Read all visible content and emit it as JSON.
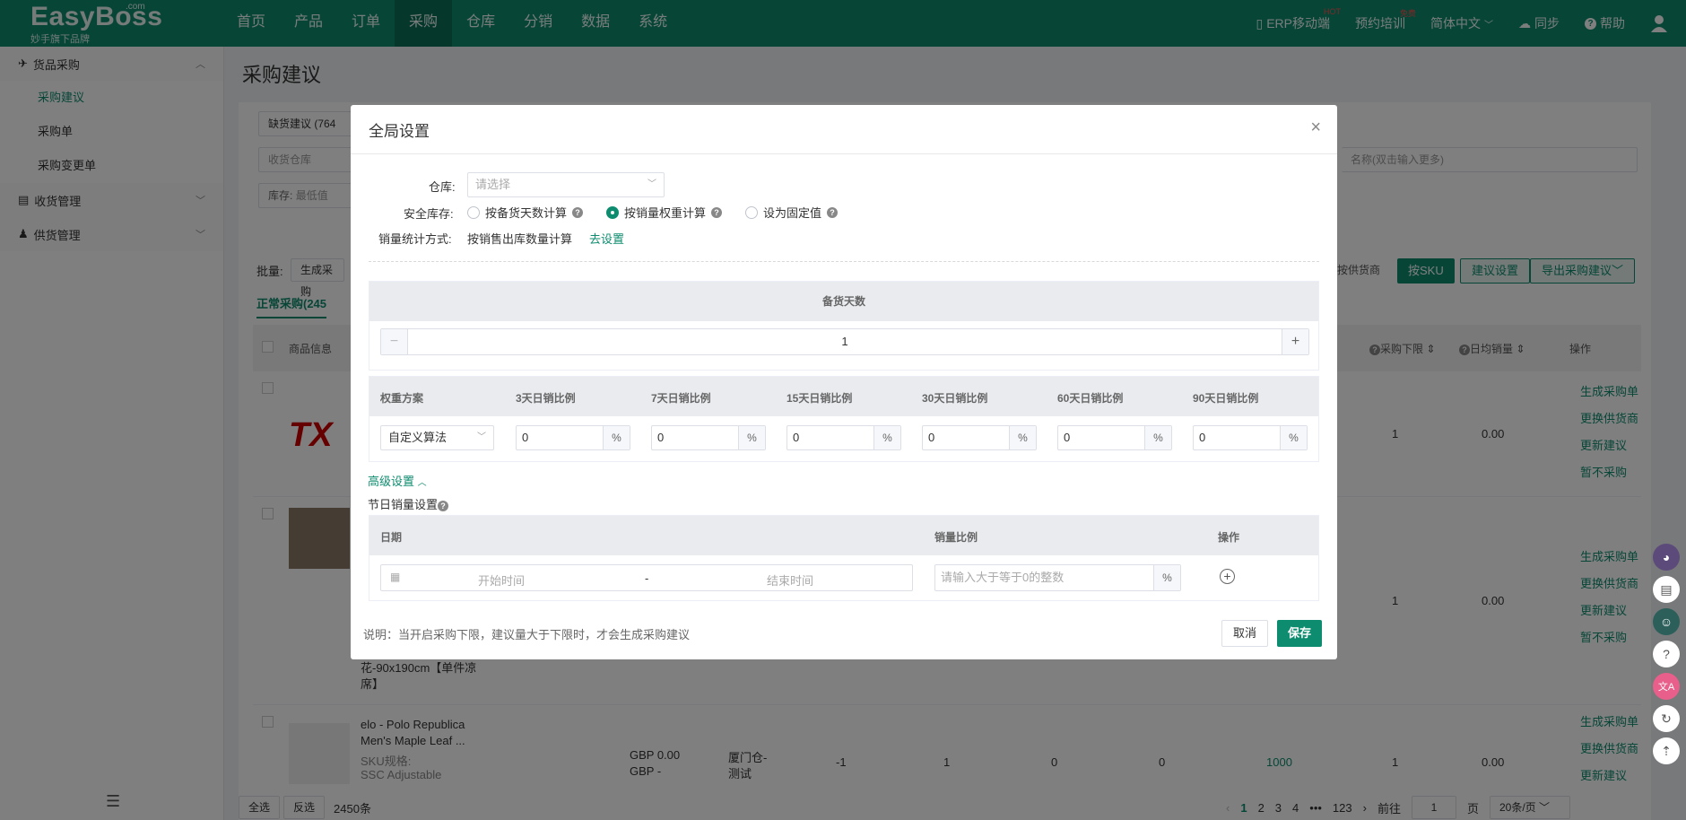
{
  "nav": {
    "logo": "EasyBoss",
    "logo_com": ".com",
    "logo_sub": "妙手旗下品牌",
    "menu": [
      "首页",
      "产品",
      "订单",
      "采购",
      "仓库",
      "分销",
      "数据",
      "系统"
    ],
    "active_index": 3,
    "right": {
      "erp_mobile": "ERP移动端",
      "erp_badge": "HOT",
      "training": "预约培训",
      "training_badge": "免费",
      "language": "简体中文",
      "sync": "同步",
      "help": "帮助"
    }
  },
  "sidebar": {
    "groups": [
      {
        "label": "货品采购",
        "items": [
          "采购建议",
          "采购单",
          "采购变更单"
        ]
      },
      {
        "label": "收货管理"
      },
      {
        "label": "供货管理"
      }
    ],
    "active_item": "采购建议"
  },
  "page": {
    "title": "采购建议",
    "filter_suggest": "缺货建议 (764",
    "filter_warehouse": "收货仓库",
    "filter_stock_label": "库存:",
    "filter_stock_min": "最低值",
    "filter_name_ph": "名称(双击输入更多)",
    "batch_label": "批量:",
    "batch_btn": "生成采购",
    "tab_normal": "正常采购(245",
    "by_supplier": "按供货商",
    "by_sku": "按SKU",
    "suggest_settings": "建议设置",
    "export": "导出采购建议",
    "table_head": {
      "product": "商品信息",
      "min_limit": "采购下限",
      "daily_sales": "日均销量",
      "ops": "操作"
    },
    "rows": [
      {
        "min": "1",
        "daily": "0.00",
        "ops": [
          "生成采购单",
          "更换供货商",
          "更新建议",
          "暂不采购"
        ]
      },
      {
        "min": "1",
        "daily": "0.00",
        "ops": [
          "生成采购单",
          "更换供货商",
          "更新建议",
          "暂不采购"
        ],
        "product_tail_1": "花-90x190cm【单件凉",
        "product_tail_2": "席】"
      },
      {
        "product_name_1": "elo - Polo Republica",
        "product_name_2": "Men's Maple Leaf ...",
        "sku_label": "SKU规格:",
        "sku_value": "SSC Adjustable",
        "price_1": "GBP 0.00",
        "price_2": "GBP -",
        "warehouse_1": "厦门仓-",
        "warehouse_2": "测试",
        "c1": "-1",
        "c2": "1",
        "c3": "0",
        "c4": "0",
        "c5": "1000",
        "min": "1",
        "daily": "0.00",
        "ops": [
          "生成采购单",
          "更换供货商",
          "更新建议"
        ]
      }
    ],
    "footer": {
      "select_all": "全选",
      "invert": "反选",
      "count": "2450条",
      "pages": [
        "1",
        "2",
        "3",
        "4",
        "•••",
        "123"
      ],
      "goto": "前往",
      "goto_val": "1",
      "page_unit": "页",
      "page_size": "20条/页"
    }
  },
  "dialog": {
    "title": "全局设置",
    "warehouse_label": "仓库:",
    "warehouse_ph": "请选择",
    "safety_label": "安全库存:",
    "safety_options": [
      "按备货天数计算",
      "按销量权重计算",
      "设为固定值"
    ],
    "safety_selected": 1,
    "stat_label": "销量统计方式:",
    "stat_value": "按销售出库数量计算",
    "stat_link": "去设置",
    "stock_days_title": "备货天数",
    "stock_days_value": "1",
    "weight_head": [
      "权重方案",
      "3天日销比例",
      "7天日销比例",
      "15天日销比例",
      "30天日销比例",
      "60天日销比例",
      "90天日销比例"
    ],
    "weight_scheme": "自定义算法",
    "weight_values": [
      "0",
      "0",
      "0",
      "0",
      "0",
      "0"
    ],
    "pct": "%",
    "advanced": "高级设置",
    "holiday_title": "节日销量设置",
    "holiday_head": {
      "date": "日期",
      "ratio": "销量比例",
      "op": "操作"
    },
    "start_ph": "开始时间",
    "dash": "-",
    "end_ph": "结束时间",
    "ratio_ph": "请输入大于等于0的整数",
    "note": "说明：当开启采购下限，建议量大于下限时，才会生成采购建议",
    "cancel": "取消",
    "save": "保存"
  },
  "colors": {
    "primary": "#0e8c6f",
    "nav": "#0e8c6f"
  }
}
